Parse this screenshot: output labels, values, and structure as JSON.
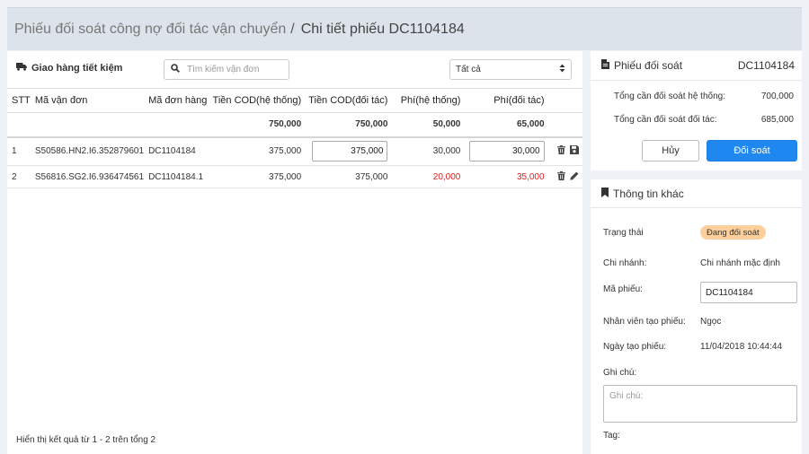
{
  "breadcrumb": {
    "parent": "Phiếu đối soát công nợ đối tác vận chuyển",
    "separator": "/",
    "current": "Chi tiết phiếu DC1104184"
  },
  "toolbar": {
    "carrier_icon": "truck-icon",
    "carrier_label": "Giao hàng tiết kiệm",
    "search_icon": "search-icon",
    "search_placeholder": "Tìm kiếm vận đơn",
    "filter_value": "Tất cả",
    "filter_icon": "chevron-updown-icon"
  },
  "table": {
    "headers": {
      "stt": "STT",
      "ma_van_don": "Mã vận đơn",
      "ma_don_hang": "Mã đơn hàng",
      "cod_he_thong": "Tiền COD(hệ thống)",
      "cod_doi_tac": "Tiền COD(đối tác)",
      "phi_he_thong": "Phí(hệ thống)",
      "phi_doi_tac": "Phí(đối tác)"
    },
    "totals": {
      "cod_he_thong": "750,000",
      "cod_doi_tac": "750,000",
      "phi_he_thong": "50,000",
      "phi_doi_tac": "65,000"
    },
    "rows": [
      {
        "stt": "1",
        "ma_van_don": "S50586.HN2.I6.352879601",
        "ma_don_hang": "DC1104184",
        "cod_he_thong": "375,000",
        "cod_doi_tac": "375,000",
        "phi_he_thong": "30,000",
        "phi_doi_tac": "30,000",
        "actions": [
          "trash-icon",
          "save-icon"
        ]
      },
      {
        "stt": "2",
        "ma_van_don": "S56816.SG2.I6.936474561",
        "ma_don_hang": "DC1104184.1",
        "cod_he_thong": "375,000",
        "cod_doi_tac": "375,000",
        "phi_he_thong": "20,000",
        "phi_doi_tac": "35,000",
        "actions": [
          "trash-icon",
          "pencil-icon"
        ]
      }
    ]
  },
  "pagination": {
    "info": "Hiển thị kết quả từ 1 - 2 trên tổng 2"
  },
  "reconcile_card": {
    "title_icon": "file-icon",
    "title": "Phiếu đối soát",
    "code": "DC1104184",
    "total_system_label": "Tổng cần đối soát hệ thống:",
    "total_system_value": "700,000",
    "total_partner_label": "Tổng cần đối soát đối tác:",
    "total_partner_value": "685,000",
    "cancel_label": "Hủy",
    "confirm_label": "Đối soát"
  },
  "info_card": {
    "title_icon": "bookmark-icon",
    "title": "Thông tin khác",
    "status_label": "Trạng thái",
    "status_value": "Đang đối soát",
    "branch_label": "Chi nhánh:",
    "branch_value": "Chi nhánh mặc định",
    "code_label": "Mã phiếu:",
    "code_value": "DC1104184",
    "creator_label": "Nhân viên tạo phiếu:",
    "creator_value": "Ngọc",
    "created_label": "Ngày tạo phiếu:",
    "created_value": "11/04/2018 10:44:44",
    "note_label": "Ghi chú:",
    "note_placeholder": "Ghi chú:",
    "tag_label": "Tag:"
  },
  "colors": {
    "primary": "#1e88f0",
    "negative": "#e02020",
    "status_badge": "#fdcf9d",
    "header_bg": "#dde3ea"
  }
}
